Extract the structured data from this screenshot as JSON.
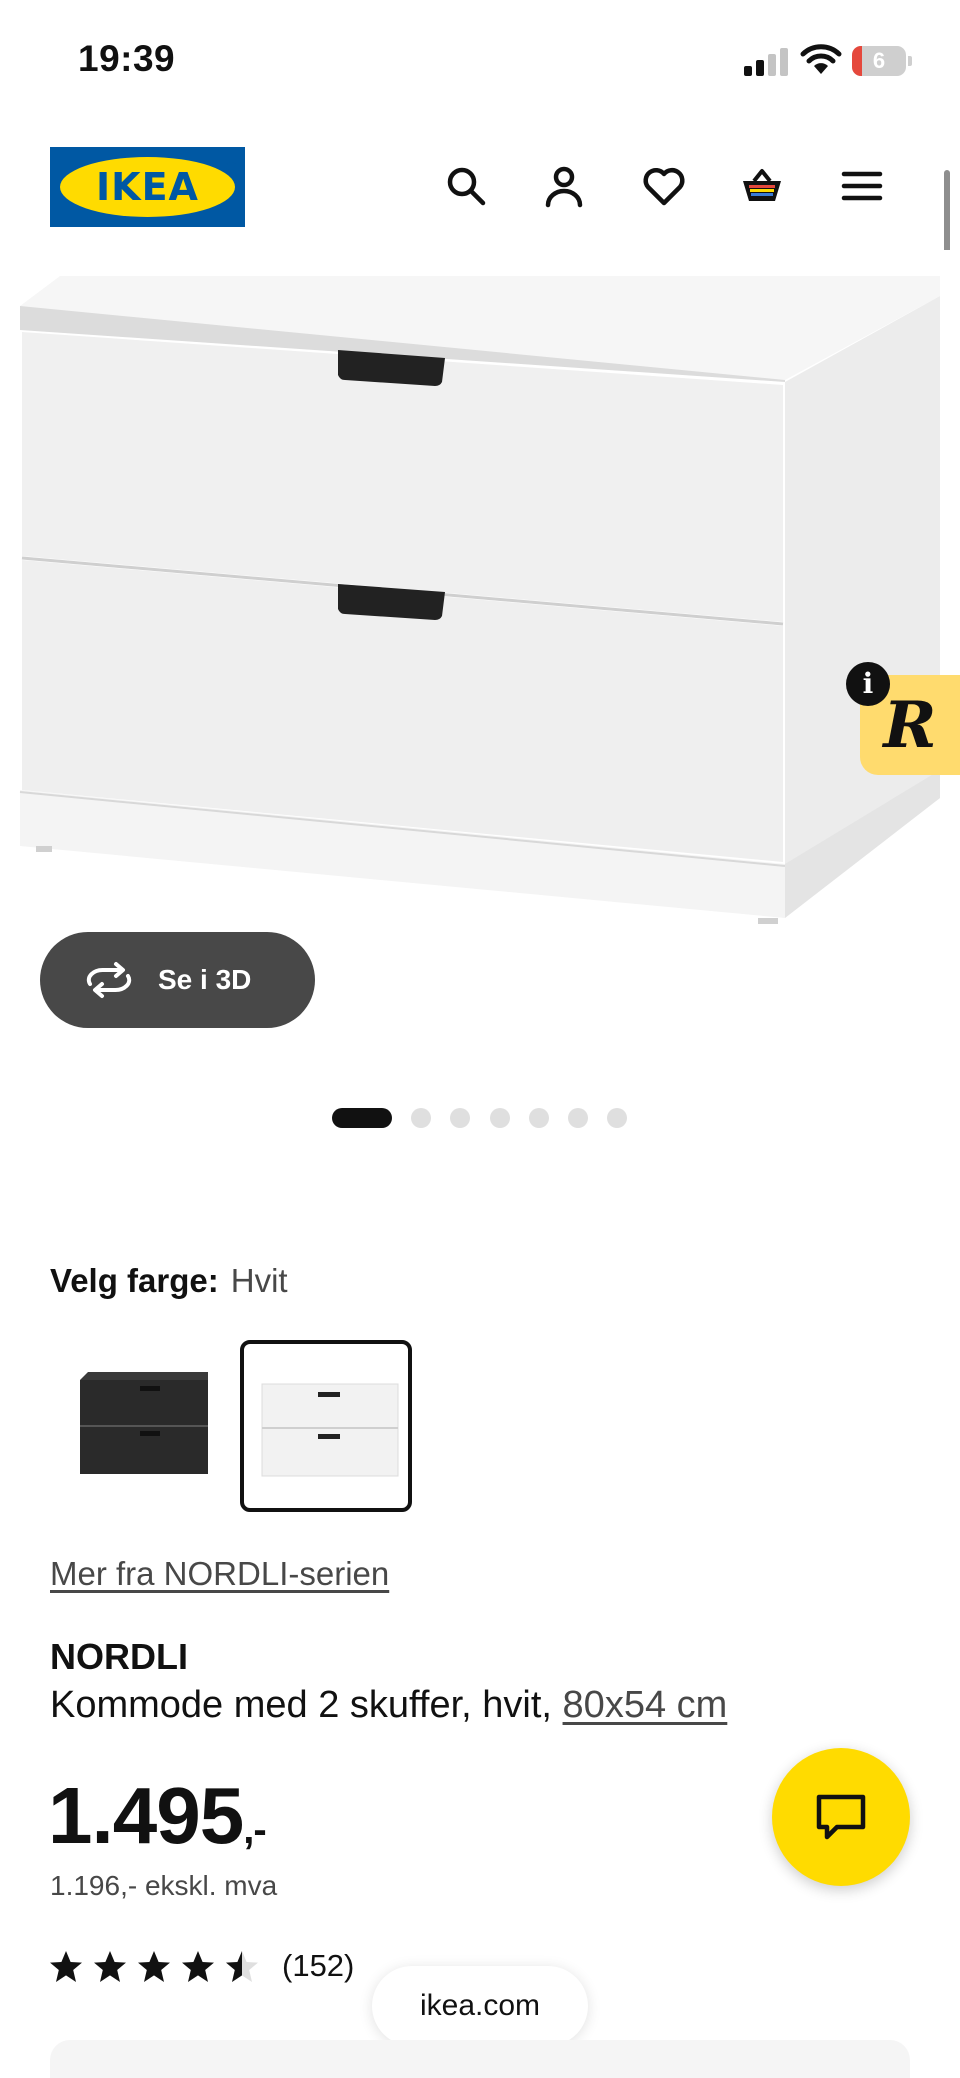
{
  "status_bar": {
    "time": "19:39",
    "battery_level": "6",
    "icons": [
      "cellular-signal-icon",
      "wifi-icon",
      "battery-icon"
    ]
  },
  "header": {
    "logo_text": "IKEA",
    "icons": [
      "search-icon",
      "account-icon",
      "heart-icon",
      "cart-icon",
      "menu-icon"
    ],
    "brand_colors": {
      "blue": "#0058a3",
      "yellow": "#ffdb00"
    }
  },
  "gallery": {
    "view_3d_label": "Se i 3D",
    "slide_count": 7,
    "active_slide": 1
  },
  "color_picker": {
    "label": "Velg farge:",
    "selected_value": "Hvit",
    "options": [
      {
        "name": "Svart",
        "color": "#2a2a2a",
        "selected": false
      },
      {
        "name": "Hvit",
        "color": "#f2f2f2",
        "selected": true
      }
    ]
  },
  "product": {
    "series_link": "Mer fra NORDLI-serien",
    "name": "NORDLI",
    "description": "Kommode med 2 skuffer, hvit, ",
    "dimensions": "80x54 cm",
    "price": "1.495",
    "price_suffix": ",-",
    "price_ex_vat": "1.196,- ekskl. mva",
    "rating": 4.5,
    "review_count": "(152)"
  },
  "browser": {
    "url": "ikea.com"
  },
  "accent_colors": {
    "chat_button": "#ffdb00",
    "badge": "#ffdb6e",
    "button_dark": "#484848"
  }
}
